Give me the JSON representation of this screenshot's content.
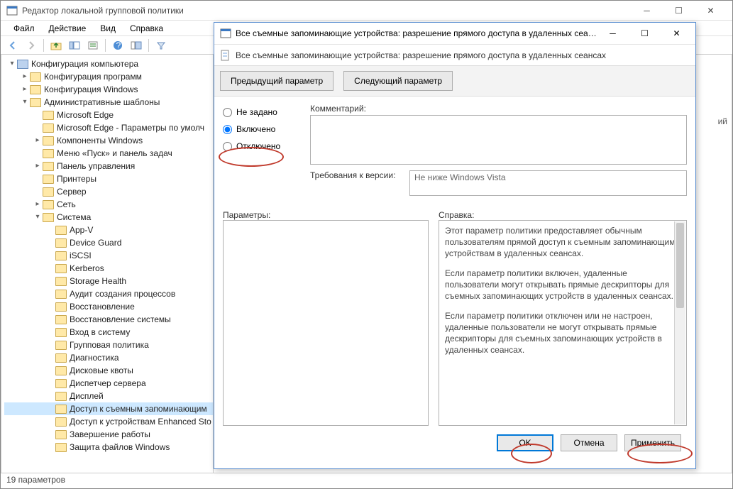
{
  "main": {
    "title": "Редактор локальной групповой политики",
    "menu": {
      "file": "Файл",
      "action": "Действие",
      "view": "Вид",
      "help": "Справка"
    },
    "status": "19 параметров",
    "right_peek": "ий",
    "tree": [
      {
        "d": 0,
        "tw": "▾",
        "ic": "comp",
        "label": "Конфигурация компьютера"
      },
      {
        "d": 1,
        "tw": "▸",
        "ic": "fld",
        "label": "Конфигурация программ"
      },
      {
        "d": 1,
        "tw": "▸",
        "ic": "fld",
        "label": "Конфигурация Windows"
      },
      {
        "d": 1,
        "tw": "▾",
        "ic": "fld",
        "label": "Административные шаблоны"
      },
      {
        "d": 2,
        "tw": "",
        "ic": "fld",
        "label": "Microsoft Edge"
      },
      {
        "d": 2,
        "tw": "",
        "ic": "fld",
        "label": "Microsoft Edge - Параметры по умолч"
      },
      {
        "d": 2,
        "tw": "▸",
        "ic": "fld",
        "label": "Компоненты Windows"
      },
      {
        "d": 2,
        "tw": "",
        "ic": "fld",
        "label": "Меню «Пуск» и панель задач"
      },
      {
        "d": 2,
        "tw": "▸",
        "ic": "fld",
        "label": "Панель управления"
      },
      {
        "d": 2,
        "tw": "",
        "ic": "fld",
        "label": "Принтеры"
      },
      {
        "d": 2,
        "tw": "",
        "ic": "fld",
        "label": "Сервер"
      },
      {
        "d": 2,
        "tw": "▸",
        "ic": "fld",
        "label": "Сеть"
      },
      {
        "d": 2,
        "tw": "▾",
        "ic": "fld",
        "label": "Система"
      },
      {
        "d": 3,
        "tw": "",
        "ic": "fld",
        "label": "App-V"
      },
      {
        "d": 3,
        "tw": "",
        "ic": "fld",
        "label": "Device Guard"
      },
      {
        "d": 3,
        "tw": "",
        "ic": "fld",
        "label": "iSCSI"
      },
      {
        "d": 3,
        "tw": "",
        "ic": "fld",
        "label": "Kerberos"
      },
      {
        "d": 3,
        "tw": "",
        "ic": "fld",
        "label": "Storage Health"
      },
      {
        "d": 3,
        "tw": "",
        "ic": "fld",
        "label": "Аудит создания процессов"
      },
      {
        "d": 3,
        "tw": "",
        "ic": "fld",
        "label": "Восстановление"
      },
      {
        "d": 3,
        "tw": "",
        "ic": "fld",
        "label": "Восстановление системы"
      },
      {
        "d": 3,
        "tw": "",
        "ic": "fld",
        "label": "Вход в систему"
      },
      {
        "d": 3,
        "tw": "",
        "ic": "fld",
        "label": "Групповая политика"
      },
      {
        "d": 3,
        "tw": "",
        "ic": "fld",
        "label": "Диагностика"
      },
      {
        "d": 3,
        "tw": "",
        "ic": "fld",
        "label": "Дисковые квоты"
      },
      {
        "d": 3,
        "tw": "",
        "ic": "fld",
        "label": "Диспетчер сервера"
      },
      {
        "d": 3,
        "tw": "",
        "ic": "fld",
        "label": "Дисплей"
      },
      {
        "d": 3,
        "tw": "",
        "ic": "fld",
        "label": "Доступ к съемным запоминающим",
        "sel": true
      },
      {
        "d": 3,
        "tw": "",
        "ic": "fld",
        "label": "Доступ к устройствам Enhanced Sto"
      },
      {
        "d": 3,
        "tw": "",
        "ic": "fld",
        "label": "Завершение работы"
      },
      {
        "d": 3,
        "tw": "",
        "ic": "fld",
        "label": "Защита файлов Windows"
      }
    ]
  },
  "modal": {
    "title": "Все съемные запоминающие устройства: разрешение прямого доступа в удаленных сеансах",
    "subtitle": "Все съемные запоминающие устройства: разрешение прямого доступа в удаленных сеансах",
    "nav": {
      "prev": "Предыдущий параметр",
      "next": "Следующий параметр"
    },
    "radios": {
      "not_set": "Не задано",
      "enabled": "Включено",
      "disabled": "Отключено"
    },
    "comment_label": "Комментарий:",
    "comment_value": "",
    "req_label": "Требования к версии:",
    "req_value": "Не ниже Windows Vista",
    "params_label": "Параметры:",
    "help_label": "Справка:",
    "help_paragraphs": [
      "Этот параметр политики предоставляет обычным пользователям прямой доступ к съемным запоминающим устройствам в удаленных сеансах.",
      "Если параметр политики включен, удаленные пользователи могут открывать прямые дескрипторы для съемных запоминающих устройств в удаленных сеансах.",
      "Если параметр политики отключен или не настроен, удаленные пользователи не могут открывать прямые дескрипторы для съемных запоминающих устройств в удаленных сеансах."
    ],
    "buttons": {
      "ok": "OK",
      "cancel": "Отмена",
      "apply": "Применить"
    }
  }
}
